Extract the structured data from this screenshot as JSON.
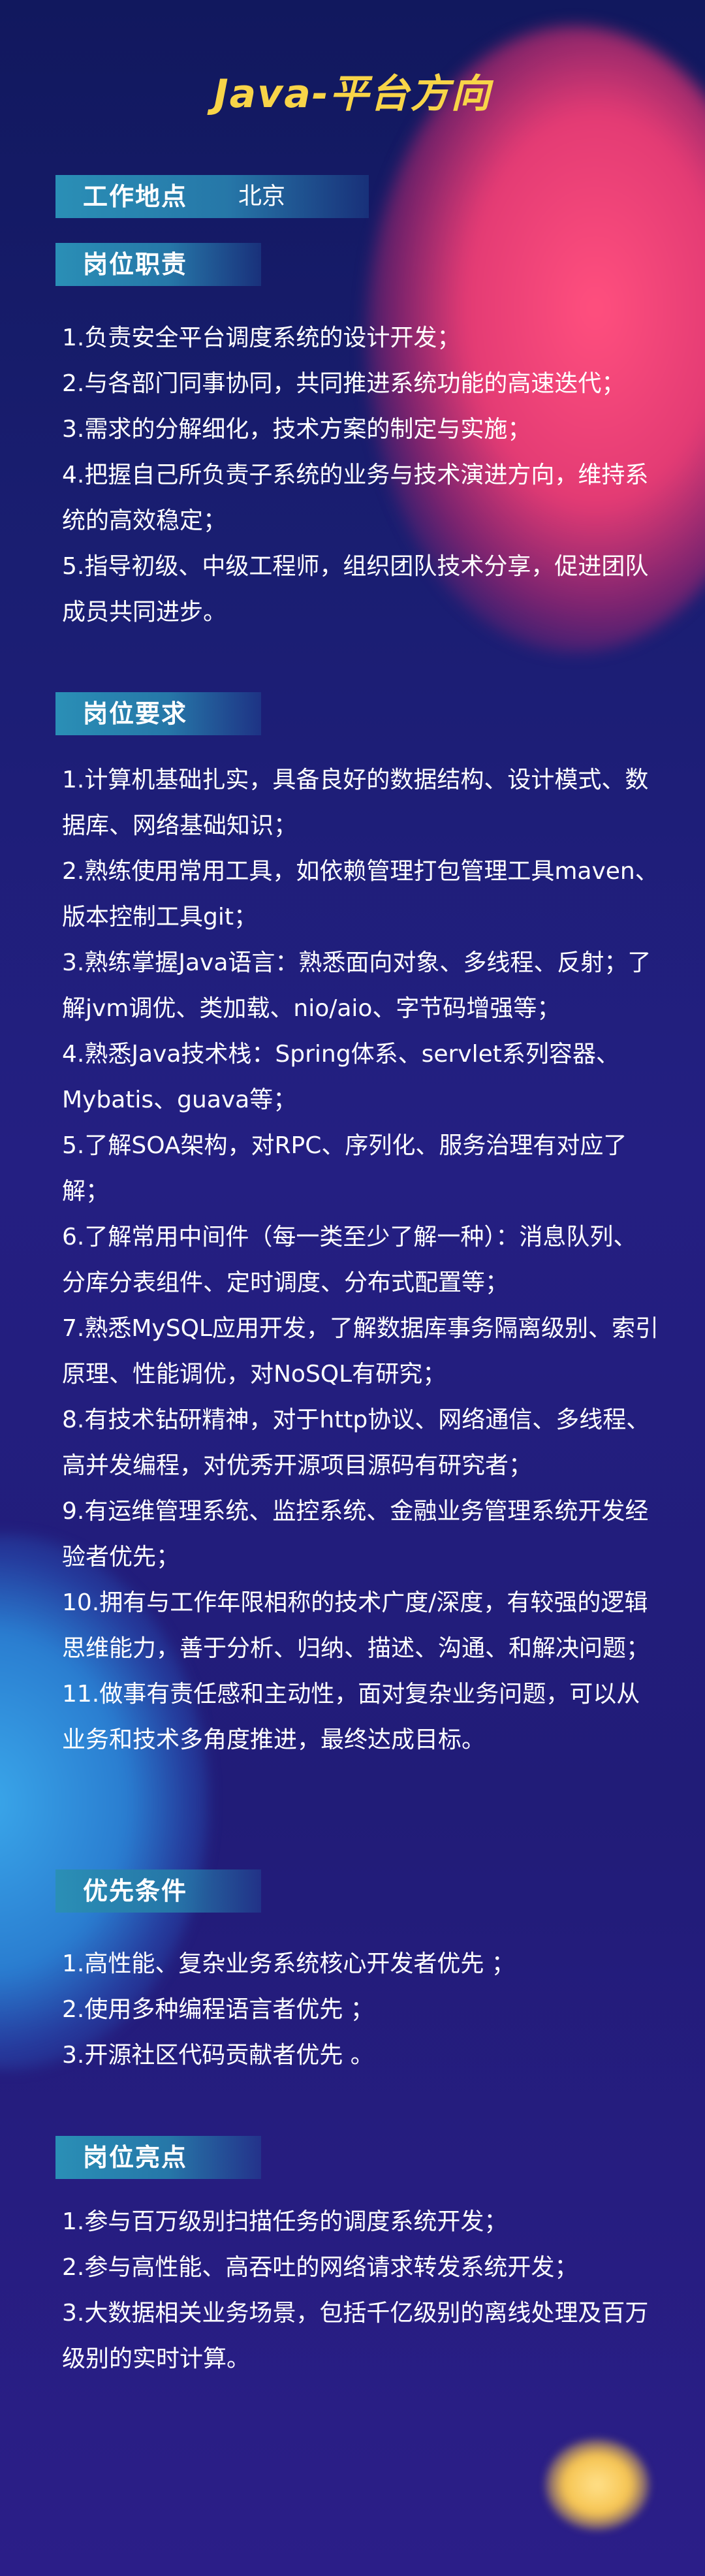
{
  "title": "Java-平台方向",
  "location": {
    "label": "工作地点",
    "value": "北京"
  },
  "sections": {
    "duties": {
      "heading": "岗位职责",
      "items": [
        "1.负责安全平台调度系统的设计开发；",
        "2.与各部门同事协同，共同推进系统功能的高速迭代；",
        "3.需求的分解细化，技术方案的制定与实施；",
        "4.把握自己所负责子系统的业务与技术演进方向，维持系统的高效稳定；",
        "5.指导初级、中级工程师，组织团队技术分享，促进团队成员共同进步。"
      ]
    },
    "requirements": {
      "heading": "岗位要求",
      "items": [
        "1.计算机基础扎实，具备良好的数据结构、设计模式、数据库、网络基础知识；",
        "2.熟练使用常用工具，如依赖管理打包管理工具maven、版本控制工具git；",
        "3.熟练掌握Java语言：熟悉面向对象、多线程、反射；了解jvm调优、类加载、nio/aio、字节码增强等；",
        "4.熟悉Java技术栈：Spring体系、servlet系列容器、Mybatis、guava等；",
        "5.了解SOA架构，对RPC、序列化、服务治理有对应了解；",
        "6.了解常用中间件（每一类至少了解一种）：消息队列、分库分表组件、定时调度、分布式配置等；",
        "7.熟悉MySQL应用开发，了解数据库事务隔离级别、索引原理、性能调优，对NoSQL有研究；",
        "8.有技术钻研精神，对于http协议、网络通信、多线程、高并发编程，对优秀开源项目源码有研究者；",
        "9.有运维管理系统、监控系统、金融业务管理系统开发经验者优先；",
        "10.拥有与工作年限相称的技术广度/深度，有较强的逻辑思维能力，善于分析、归纳、描述、沟通、和解决问题；",
        "11.做事有责任感和主动性，面对复杂业务问题，可以从业务和技术多角度推进，最终达成目标。"
      ]
    },
    "preferred": {
      "heading": "优先条件",
      "items": [
        "1.高性能、复杂业务系统核心开发者优先 ；",
        "2.使用多种编程语言者优先 ；",
        "3.开源社区代码贡献者优先 。"
      ]
    },
    "highlights": {
      "heading": "岗位亮点",
      "items": [
        "1.参与百万级别扫描任务的调度系统开发；",
        "2.参与高性能、高吞吐的网络请求转发系统开发；",
        "3.大数据相关业务场景，包括千亿级别的离线处理及百万级别的实时计算。"
      ]
    }
  }
}
